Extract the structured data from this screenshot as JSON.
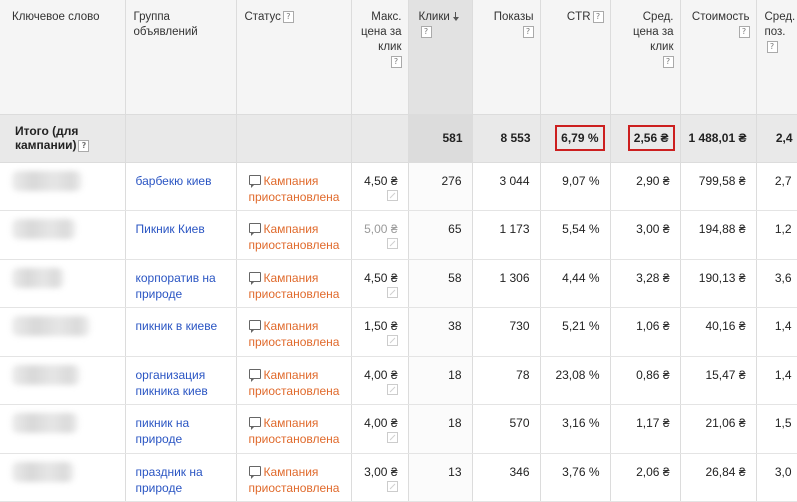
{
  "columns": [
    {
      "label": "Ключевое слово",
      "help": false
    },
    {
      "label": "Группа объявлений",
      "help": false
    },
    {
      "label": "Статус",
      "help": true
    },
    {
      "label": "Макс. цена за клик",
      "help": true
    },
    {
      "label": "Клики",
      "help": true,
      "sorted": true
    },
    {
      "label": "Показы",
      "help": true
    },
    {
      "label": "CTR",
      "help": true
    },
    {
      "label": "Сред. цена за клик",
      "help": true
    },
    {
      "label": "Стоимость",
      "help": true
    },
    {
      "label": "Сред. поз.",
      "help": true
    }
  ],
  "help_glyph": "?",
  "total": {
    "label": "Итого (для кампании)",
    "clicks": "581",
    "impressions": "8 553",
    "ctr": "6,79 %",
    "avg_cpc": "2,56 ₴",
    "cost": "1 488,01 ₴",
    "avg_pos": "2,4"
  },
  "highlight_color": "#cc1f1f",
  "status_color": "#e06a2c",
  "link_color": "#2a55c3",
  "rows": [
    {
      "group": "барбекю киев",
      "status": "Кампания приостановлена",
      "max_cpc": "4,50 ₴",
      "max_cpc_dim": false,
      "clicks": "276",
      "impressions": "3 044",
      "ctr": "9,07 %",
      "avg_cpc": "2,90 ₴",
      "cost": "799,58 ₴",
      "avg_pos": "2,7"
    },
    {
      "group": "Пикник Киев",
      "status": "Кампания приостановлена",
      "max_cpc": "5,00 ₴",
      "max_cpc_dim": true,
      "clicks": "65",
      "impressions": "1 173",
      "ctr": "5,54 %",
      "avg_cpc": "3,00 ₴",
      "cost": "194,88 ₴",
      "avg_pos": "1,2"
    },
    {
      "group": "корпоратив на природе",
      "status": "Кампания приостановлена",
      "max_cpc": "4,50 ₴",
      "max_cpc_dim": false,
      "clicks": "58",
      "impressions": "1 306",
      "ctr": "4,44 %",
      "avg_cpc": "3,28 ₴",
      "cost": "190,13 ₴",
      "avg_pos": "3,6"
    },
    {
      "group": "пикник в киеве",
      "status": "Кампания приостановлена",
      "max_cpc": "1,50 ₴",
      "max_cpc_dim": false,
      "clicks": "38",
      "impressions": "730",
      "ctr": "5,21 %",
      "avg_cpc": "1,06 ₴",
      "cost": "40,16 ₴",
      "avg_pos": "1,4"
    },
    {
      "group": "организация пикника киев",
      "status": "Кампания приостановлена",
      "max_cpc": "4,00 ₴",
      "max_cpc_dim": false,
      "clicks": "18",
      "impressions": "78",
      "ctr": "23,08 %",
      "avg_cpc": "0,86 ₴",
      "cost": "15,47 ₴",
      "avg_pos": "1,4"
    },
    {
      "group": "пикник на природе",
      "status": "Кампания приостановлена",
      "max_cpc": "4,00 ₴",
      "max_cpc_dim": false,
      "clicks": "18",
      "impressions": "570",
      "ctr": "3,16 %",
      "avg_cpc": "1,17 ₴",
      "cost": "21,06 ₴",
      "avg_pos": "1,5"
    },
    {
      "group": "праздник на природе",
      "status": "Кампания приостановлена",
      "max_cpc": "3,00 ₴",
      "max_cpc_dim": false,
      "clicks": "13",
      "impressions": "346",
      "ctr": "3,76 %",
      "avg_cpc": "2,06 ₴",
      "cost": "26,84 ₴",
      "avg_pos": "3,0"
    }
  ]
}
